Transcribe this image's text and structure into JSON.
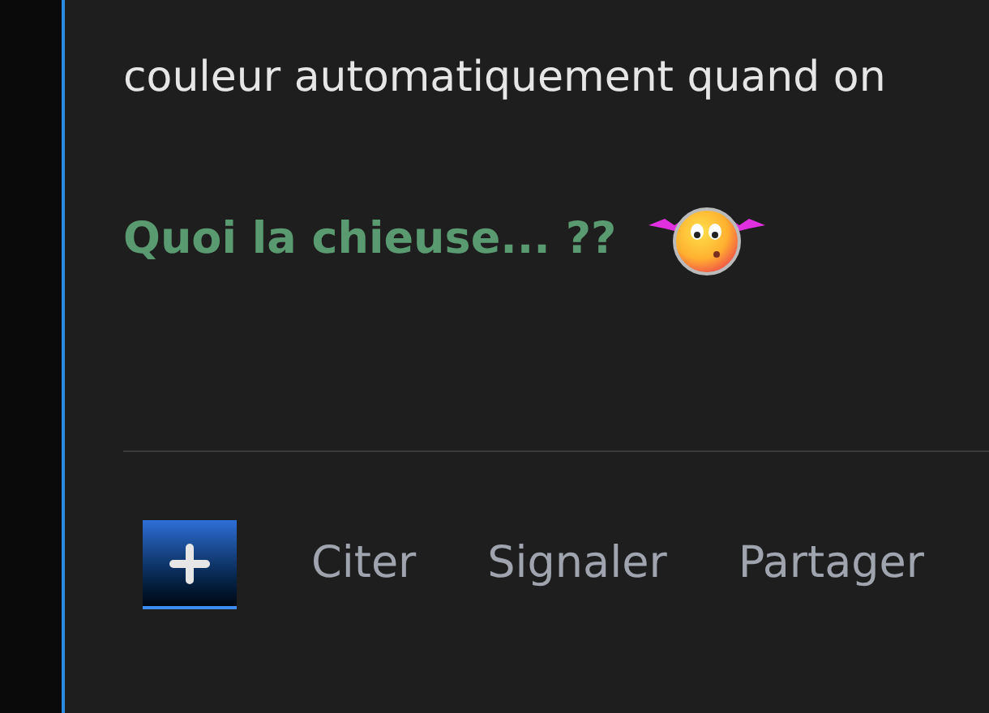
{
  "post": {
    "text": "couleur automatiquement quand on",
    "highlight": "Quoi la chieuse... ??"
  },
  "actions": [
    "Citer",
    "Signaler",
    "Partager"
  ]
}
